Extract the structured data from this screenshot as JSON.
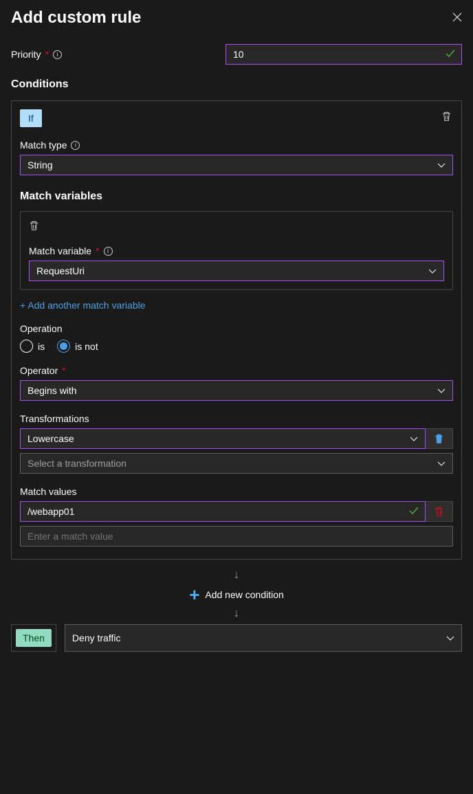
{
  "header": {
    "title": "Add custom rule"
  },
  "priority": {
    "label": "Priority",
    "value": "10"
  },
  "conditions": {
    "label": "Conditions",
    "if_label": "If",
    "match_type": {
      "label": "Match type",
      "value": "String"
    },
    "match_variables": {
      "label": "Match variables",
      "field_label": "Match variable",
      "value": "RequestUri",
      "add_another": "+ Add another match variable"
    },
    "operation": {
      "label": "Operation",
      "is_label": "is",
      "is_not_label": "is not",
      "selected": "is_not"
    },
    "operator": {
      "label": "Operator",
      "value": "Begins with"
    },
    "transformations": {
      "label": "Transformations",
      "items": [
        "Lowercase"
      ],
      "placeholder": "Select a transformation"
    },
    "match_values": {
      "label": "Match values",
      "items": [
        "/webapp01"
      ],
      "placeholder": "Enter a match value"
    }
  },
  "add_condition": "Add new condition",
  "then": {
    "label": "Then",
    "value": "Deny traffic"
  }
}
